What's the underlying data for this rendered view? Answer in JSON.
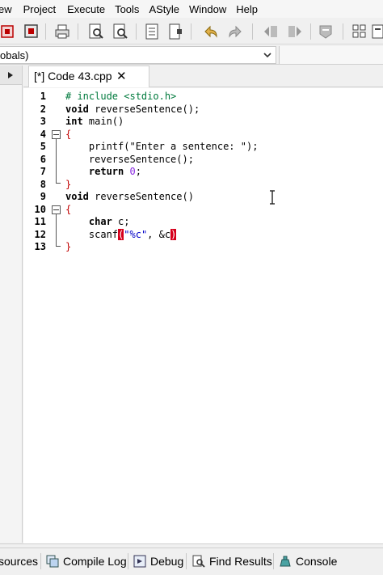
{
  "menu": [
    "ew",
    "Project",
    "Execute",
    "Tools",
    "AStyle",
    "Window",
    "Help"
  ],
  "toolbar": {
    "icons": [
      "class-browser-icon",
      "new-class-icon",
      "print-icon",
      "find-icon",
      "find-replace-icon",
      "goto-icon",
      "bookmark-icon",
      "undo-icon",
      "redo-icon",
      "indent-icon",
      "unindent-icon",
      "toggle-comment-icon",
      "grid-icon",
      "code-completion-icon"
    ]
  },
  "selector": {
    "value": "obals)"
  },
  "tab": {
    "label": "[*] Code 43.cpp",
    "close": "✕"
  },
  "editor": {
    "line_numbers": [
      "1",
      "2",
      "3",
      "4",
      "5",
      "6",
      "7",
      "8",
      "9",
      "10",
      "11",
      "12",
      "13"
    ],
    "lines": {
      "l1": "# include <stdio.h>",
      "l2_kw": "void",
      "l2_rest": " reverseSentence();",
      "l3_kw": "int",
      "l3_rest": " main()",
      "l4": "{",
      "l5_a": "    printf(",
      "l5_str": "\"Enter a sentence: \"",
      "l5_b": ");",
      "l6": "    reverseSentence();",
      "l7_kw": "    return",
      "l7_num": " 0",
      "l7_b": ";",
      "l8": "}",
      "l9_kw": "void",
      "l9_rest": " reverseSentence()",
      "l10": "{",
      "l11_kw": "    char",
      "l11_rest": " c;",
      "l12_a": "    scanf",
      "l12_open": "(",
      "l12_str": "\"%c\"",
      "l12_b": ", &c",
      "l12_close": ")",
      "l13": "}"
    }
  },
  "bottom_tabs": [
    {
      "label": "sources",
      "icon": "resources-icon"
    },
    {
      "label": "Compile Log",
      "icon": "compile-log-icon"
    },
    {
      "label": "Debug",
      "icon": "debug-icon"
    },
    {
      "label": "Find Results",
      "icon": "find-results-icon"
    },
    {
      "label": "Console",
      "icon": "console-icon"
    }
  ],
  "colors": {
    "accent_red": "#d6001c",
    "keyword": "#000000",
    "string": "#0000c8",
    "number": "#8a2be2",
    "preprocessor": "#007a3d"
  }
}
